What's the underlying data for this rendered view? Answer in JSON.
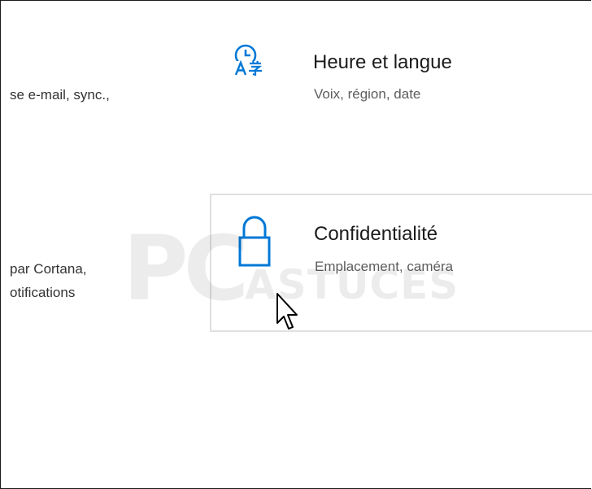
{
  "left_column": {
    "line1": "se e-mail, sync.,",
    "line2": "par Cortana,",
    "line3": "otifications"
  },
  "cards": [
    {
      "title": "Heure et langue",
      "subtitle": "Voix, région, date",
      "icon": "time-language-icon"
    },
    {
      "title": "Confidentialité",
      "subtitle": "Emplacement, caméra",
      "icon": "lock-icon"
    }
  ],
  "watermark": {
    "text_main": "PC",
    "text_secondary": "ASTUCES"
  },
  "accent_color": "#0078d7"
}
